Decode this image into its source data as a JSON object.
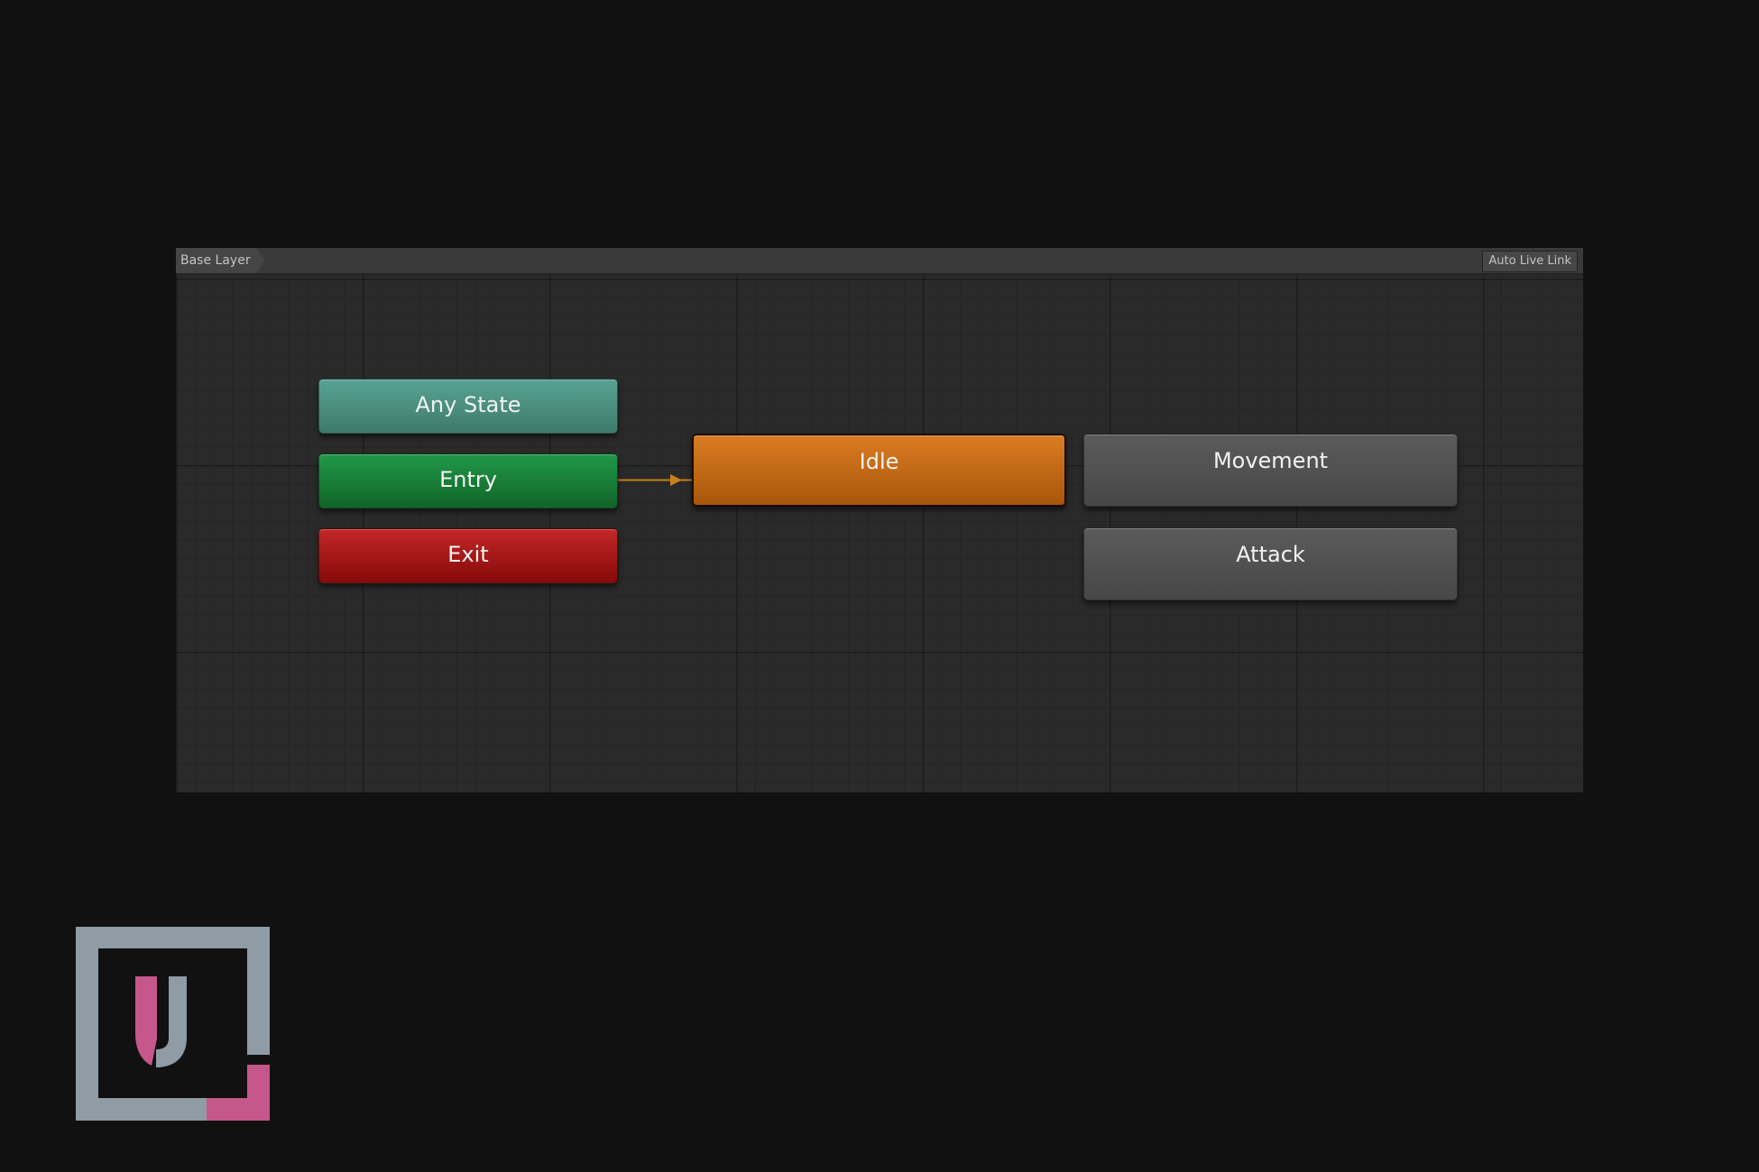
{
  "toolbar": {
    "breadcrumb": "Base Layer",
    "live_link_label": "Auto Live Link"
  },
  "states": {
    "any_state": "Any State",
    "entry": "Entry",
    "exit": "Exit",
    "idle": "Idle",
    "movement": "Movement",
    "attack": "Attack"
  },
  "colors": {
    "any_state": "#4e8f81",
    "entry": "#1a7c37",
    "exit": "#a81515",
    "default_state": "#c26714",
    "state": "#515151",
    "transition": "#c68119",
    "logo_frame": "#8f9ba5",
    "logo_accent": "#c6578a"
  },
  "transitions": [
    {
      "from": "entry",
      "to": "idle"
    }
  ],
  "icons": {
    "logo": "u-bracket-logo"
  }
}
